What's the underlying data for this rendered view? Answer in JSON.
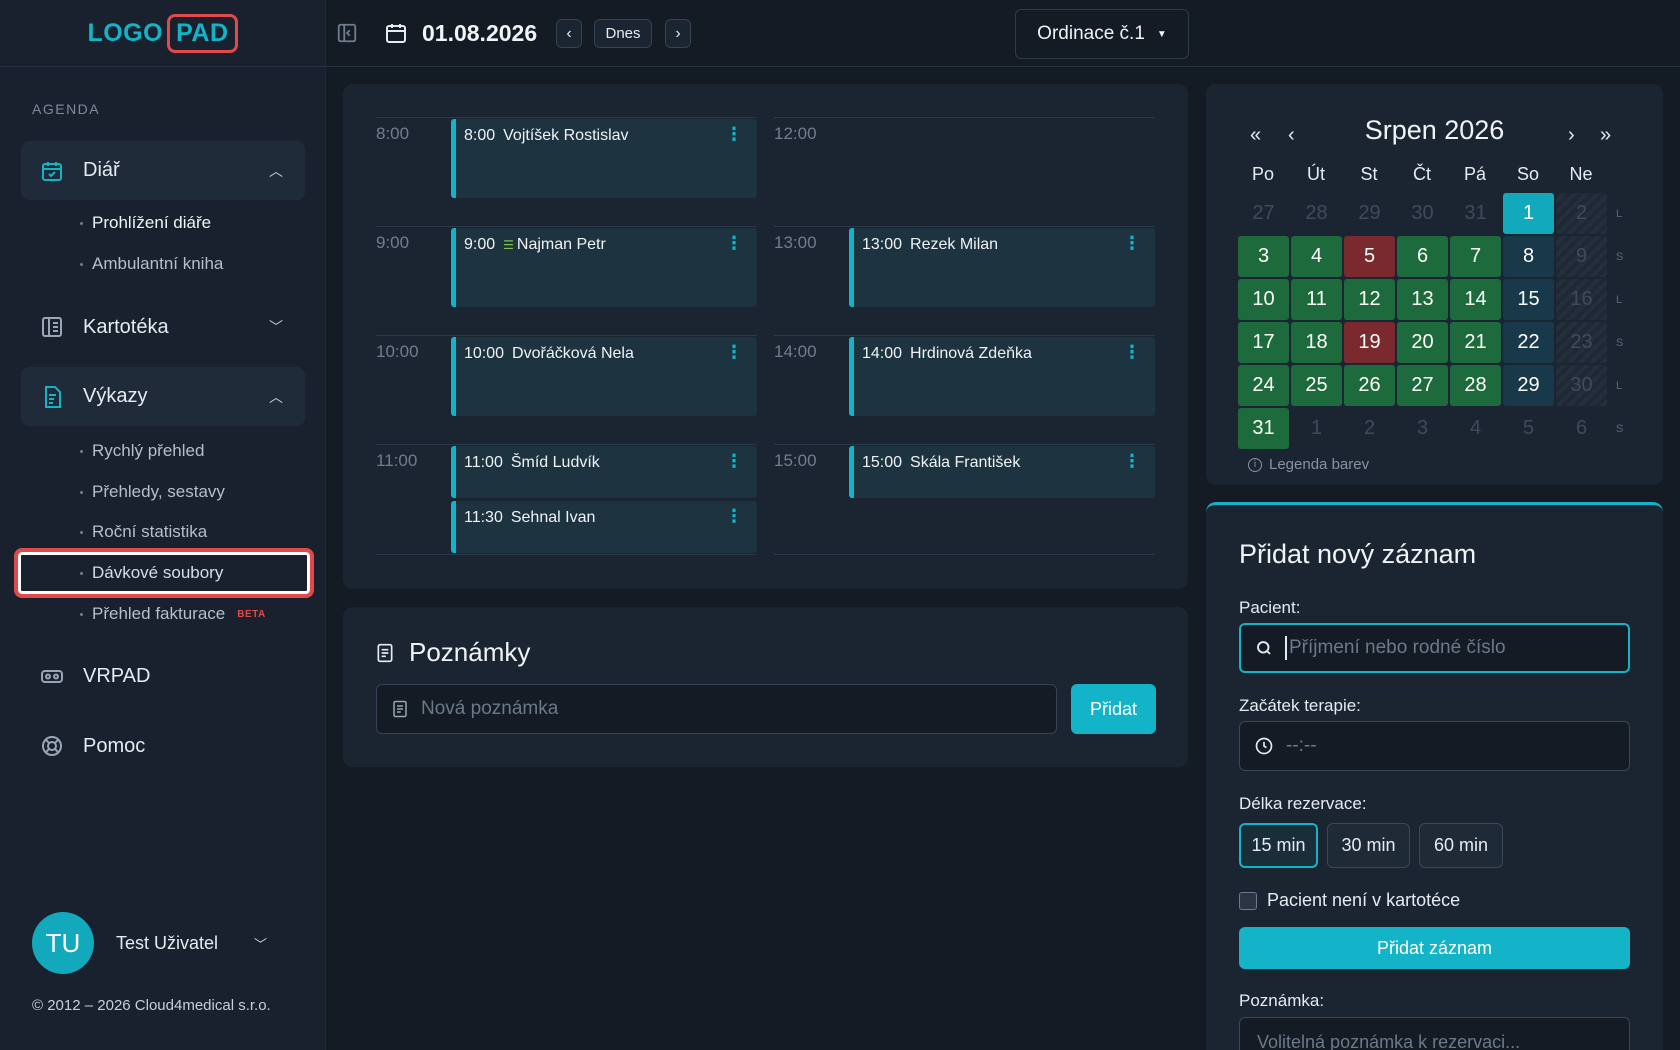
{
  "logo": {
    "part1": "LOGO",
    "part2": "PAD"
  },
  "sidebar": {
    "section": "AGENDA",
    "diar": {
      "label": "Diář",
      "items": [
        "Prohlížení diáře",
        "Ambulantní kniha"
      ]
    },
    "kartoteka": {
      "label": "Kartotéka"
    },
    "vykazy": {
      "label": "Výkazy",
      "items": [
        "Rychlý přehled",
        "Přehledy, sestavy",
        "Roční statistika",
        "Dávkové soubory",
        "Přehled fakturace"
      ],
      "beta": "BETA"
    },
    "vrpad": {
      "label": "VRPAD"
    },
    "pomoc": {
      "label": "Pomoc"
    },
    "user": {
      "initials": "TU",
      "name": "Test Uživatel"
    },
    "copyright": "© 2012 – 2026 Cloud4medical s.r.o."
  },
  "topbar": {
    "date": "01.08.2026",
    "today": "Dnes",
    "ordinace": "Ordinace č.1"
  },
  "schedule": {
    "times_left": [
      "8:00",
      "9:00",
      "10:00",
      "11:00"
    ],
    "times_right": [
      "12:00",
      "13:00",
      "14:00",
      "15:00"
    ],
    "appointments": [
      {
        "time": "8:00",
        "name": "Vojtíšek Rostislav"
      },
      {
        "time": "9:00",
        "name": "Najman Petr"
      },
      {
        "time": "10:00",
        "name": "Dvořáčková Nela"
      },
      {
        "time": "11:00",
        "name": "Šmíd Ludvík"
      },
      {
        "time": "11:30",
        "name": "Sehnal Ivan"
      },
      {
        "time": "13:00",
        "name": "Rezek Milan"
      },
      {
        "time": "14:00",
        "name": "Hrdinová Zdeňka"
      },
      {
        "time": "15:00",
        "name": "Skála František"
      }
    ]
  },
  "notes": {
    "title": "Poznámky",
    "placeholder": "Nová poznámka",
    "button": "Přidat"
  },
  "calendar": {
    "title": "Srpen 2026",
    "nav": {
      "first": "«",
      "prev": "‹",
      "next": "›",
      "last": "»"
    },
    "dow": [
      "Po",
      "Út",
      "St",
      "Čt",
      "Pá",
      "So",
      "Ne"
    ],
    "weeks": [
      [
        "27",
        "28",
        "29",
        "30",
        "31",
        "1",
        "2"
      ],
      [
        "3",
        "4",
        "5",
        "6",
        "7",
        "8",
        "9"
      ],
      [
        "10",
        "11",
        "12",
        "13",
        "14",
        "15",
        "16"
      ],
      [
        "17",
        "18",
        "19",
        "20",
        "21",
        "22",
        "23"
      ],
      [
        "24",
        "25",
        "26",
        "27",
        "28",
        "29",
        "30"
      ],
      [
        "31",
        "1",
        "2",
        "3",
        "4",
        "5",
        "6"
      ]
    ],
    "week_markers": [
      "L",
      "S",
      "L",
      "S",
      "L",
      "S"
    ],
    "legend": "Legenda barev",
    "colors": {
      "free": "#1d6a3c",
      "full": "#7a2a2e",
      "today": "#13a9bc"
    }
  },
  "form": {
    "title": "Přidat nový záznam",
    "patient_label": "Pacient:",
    "patient_placeholder": "Příjmení nebo rodné číslo",
    "start_label": "Začátek terapie:",
    "start_placeholder": "--:--",
    "length_label": "Délka rezervace:",
    "durations": [
      "15 min",
      "30 min",
      "60 min"
    ],
    "not_in_registry": "Pacient není v kartotéce",
    "submit": "Přidat záznam",
    "note_label": "Poznámka:",
    "note_placeholder": "Volitelná poznámka k rezervaci..."
  }
}
